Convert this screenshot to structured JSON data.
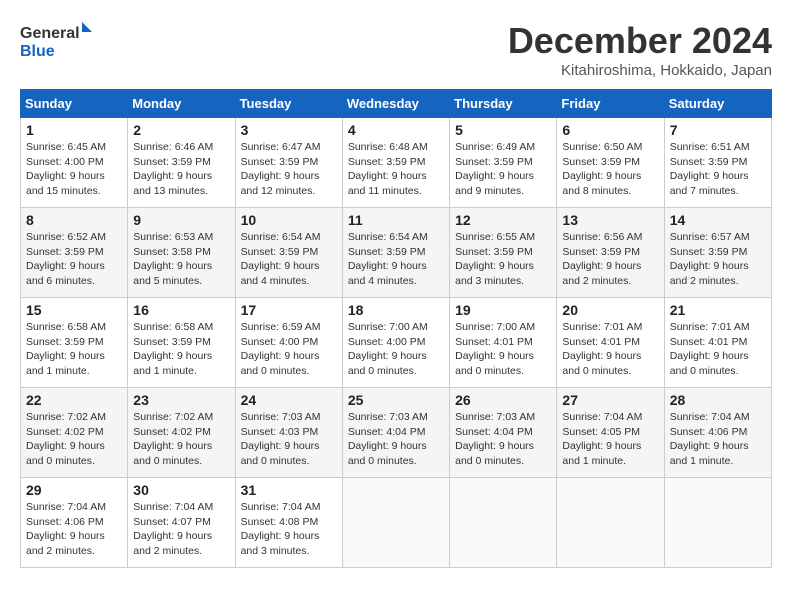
{
  "logo": {
    "line1": "General",
    "line2": "Blue"
  },
  "title": "December 2024",
  "subtitle": "Kitahiroshima, Hokkaido, Japan",
  "days_of_week": [
    "Sunday",
    "Monday",
    "Tuesday",
    "Wednesday",
    "Thursday",
    "Friday",
    "Saturday"
  ],
  "weeks": [
    [
      {
        "day": "1",
        "info": "Sunrise: 6:45 AM\nSunset: 4:00 PM\nDaylight: 9 hours\nand 15 minutes."
      },
      {
        "day": "2",
        "info": "Sunrise: 6:46 AM\nSunset: 3:59 PM\nDaylight: 9 hours\nand 13 minutes."
      },
      {
        "day": "3",
        "info": "Sunrise: 6:47 AM\nSunset: 3:59 PM\nDaylight: 9 hours\nand 12 minutes."
      },
      {
        "day": "4",
        "info": "Sunrise: 6:48 AM\nSunset: 3:59 PM\nDaylight: 9 hours\nand 11 minutes."
      },
      {
        "day": "5",
        "info": "Sunrise: 6:49 AM\nSunset: 3:59 PM\nDaylight: 9 hours\nand 9 minutes."
      },
      {
        "day": "6",
        "info": "Sunrise: 6:50 AM\nSunset: 3:59 PM\nDaylight: 9 hours\nand 8 minutes."
      },
      {
        "day": "7",
        "info": "Sunrise: 6:51 AM\nSunset: 3:59 PM\nDaylight: 9 hours\nand 7 minutes."
      }
    ],
    [
      {
        "day": "8",
        "info": "Sunrise: 6:52 AM\nSunset: 3:59 PM\nDaylight: 9 hours\nand 6 minutes."
      },
      {
        "day": "9",
        "info": "Sunrise: 6:53 AM\nSunset: 3:58 PM\nDaylight: 9 hours\nand 5 minutes."
      },
      {
        "day": "10",
        "info": "Sunrise: 6:54 AM\nSunset: 3:59 PM\nDaylight: 9 hours\nand 4 minutes."
      },
      {
        "day": "11",
        "info": "Sunrise: 6:54 AM\nSunset: 3:59 PM\nDaylight: 9 hours\nand 4 minutes."
      },
      {
        "day": "12",
        "info": "Sunrise: 6:55 AM\nSunset: 3:59 PM\nDaylight: 9 hours\nand 3 minutes."
      },
      {
        "day": "13",
        "info": "Sunrise: 6:56 AM\nSunset: 3:59 PM\nDaylight: 9 hours\nand 2 minutes."
      },
      {
        "day": "14",
        "info": "Sunrise: 6:57 AM\nSunset: 3:59 PM\nDaylight: 9 hours\nand 2 minutes."
      }
    ],
    [
      {
        "day": "15",
        "info": "Sunrise: 6:58 AM\nSunset: 3:59 PM\nDaylight: 9 hours\nand 1 minute."
      },
      {
        "day": "16",
        "info": "Sunrise: 6:58 AM\nSunset: 3:59 PM\nDaylight: 9 hours\nand 1 minute."
      },
      {
        "day": "17",
        "info": "Sunrise: 6:59 AM\nSunset: 4:00 PM\nDaylight: 9 hours\nand 0 minutes."
      },
      {
        "day": "18",
        "info": "Sunrise: 7:00 AM\nSunset: 4:00 PM\nDaylight: 9 hours\nand 0 minutes."
      },
      {
        "day": "19",
        "info": "Sunrise: 7:00 AM\nSunset: 4:01 PM\nDaylight: 9 hours\nand 0 minutes."
      },
      {
        "day": "20",
        "info": "Sunrise: 7:01 AM\nSunset: 4:01 PM\nDaylight: 9 hours\nand 0 minutes."
      },
      {
        "day": "21",
        "info": "Sunrise: 7:01 AM\nSunset: 4:01 PM\nDaylight: 9 hours\nand 0 minutes."
      }
    ],
    [
      {
        "day": "22",
        "info": "Sunrise: 7:02 AM\nSunset: 4:02 PM\nDaylight: 9 hours\nand 0 minutes."
      },
      {
        "day": "23",
        "info": "Sunrise: 7:02 AM\nSunset: 4:02 PM\nDaylight: 9 hours\nand 0 minutes."
      },
      {
        "day": "24",
        "info": "Sunrise: 7:03 AM\nSunset: 4:03 PM\nDaylight: 9 hours\nand 0 minutes."
      },
      {
        "day": "25",
        "info": "Sunrise: 7:03 AM\nSunset: 4:04 PM\nDaylight: 9 hours\nand 0 minutes."
      },
      {
        "day": "26",
        "info": "Sunrise: 7:03 AM\nSunset: 4:04 PM\nDaylight: 9 hours\nand 0 minutes."
      },
      {
        "day": "27",
        "info": "Sunrise: 7:04 AM\nSunset: 4:05 PM\nDaylight: 9 hours\nand 1 minute."
      },
      {
        "day": "28",
        "info": "Sunrise: 7:04 AM\nSunset: 4:06 PM\nDaylight: 9 hours\nand 1 minute."
      }
    ],
    [
      {
        "day": "29",
        "info": "Sunrise: 7:04 AM\nSunset: 4:06 PM\nDaylight: 9 hours\nand 2 minutes."
      },
      {
        "day": "30",
        "info": "Sunrise: 7:04 AM\nSunset: 4:07 PM\nDaylight: 9 hours\nand 2 minutes."
      },
      {
        "day": "31",
        "info": "Sunrise: 7:04 AM\nSunset: 4:08 PM\nDaylight: 9 hours\nand 3 minutes."
      },
      {
        "day": "",
        "info": ""
      },
      {
        "day": "",
        "info": ""
      },
      {
        "day": "",
        "info": ""
      },
      {
        "day": "",
        "info": ""
      }
    ]
  ]
}
